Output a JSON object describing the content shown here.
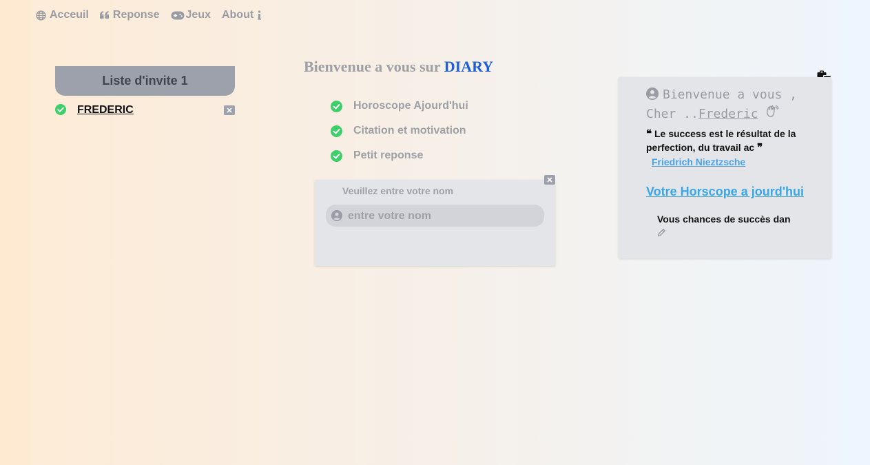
{
  "nav": {
    "items": [
      {
        "label": "Acceuil",
        "icon": "globe-icon"
      },
      {
        "label": "Reponse",
        "icon": "quote-icon"
      },
      {
        "label": "Jeux",
        "icon": "gamepad-icon"
      },
      {
        "label": "About",
        "icon": "info-icon"
      }
    ]
  },
  "guest_list": {
    "title": "Liste d'invite 1",
    "guests": [
      {
        "name": "FREDERIC",
        "status": "checked"
      }
    ]
  },
  "welcome": {
    "prefix": "Bienvenue a vous sur",
    "brand": "DIARY",
    "features": [
      {
        "label": "Horoscope Ajourd'hui"
      },
      {
        "label": "Citation et motivation"
      },
      {
        "label": "Petit reponse"
      }
    ]
  },
  "name_card": {
    "prompt": "Veuillez entre votre nom",
    "input_placeholder": "entre votre nom",
    "input_value": ""
  },
  "right_card": {
    "greeting_line1": "Bienvenue a vous ,",
    "greeting_line2_prefix": "Cher ..",
    "greeting_name": "Frederic",
    "quote_text": "Le success est le résultat de la perfection, du travail ac",
    "quote_author": "Friedrich Nieztzsche",
    "horoscope_link": "Votre Horscope a jourd'hui",
    "chances_text": "Vous chances de succès dan"
  },
  "colors": {
    "brand": "#1d5fd8",
    "check_green": "#3ecf6a",
    "link_blue": "#3aa6e8",
    "muted_text": "#9ea0a6"
  }
}
